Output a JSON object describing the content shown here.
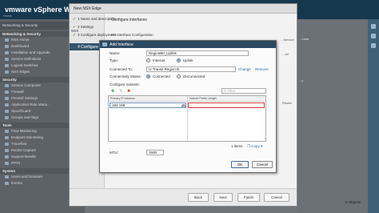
{
  "app": {
    "title": "vmware vSphere Web Client",
    "home_label": "Home"
  },
  "navigator": {
    "header": "Networking & Security",
    "sections": [
      {
        "label": "Networking & Security"
      },
      {
        "label": "Security"
      },
      {
        "label": "Tools"
      },
      {
        "label": "System"
      }
    ],
    "items": [
      {
        "label": "NSX Home"
      },
      {
        "label": "Dashboard"
      },
      {
        "label": "Installation and Upgrade"
      },
      {
        "label": "Service Definitions"
      },
      {
        "label": "Logical Switches"
      },
      {
        "label": "NSX Edges"
      },
      {
        "label": "Service Composer"
      },
      {
        "label": "Firewall"
      },
      {
        "label": "Firewall Settings"
      },
      {
        "label": "Application Rule Mana..."
      },
      {
        "label": "SpoofGuard"
      },
      {
        "label": "Groups and Tags"
      },
      {
        "label": "Flow Monitoring"
      },
      {
        "label": "Endpoint Monitoring"
      },
      {
        "label": "Traceflow"
      },
      {
        "label": "Packet Capture"
      },
      {
        "label": "Support Bundle"
      },
      {
        "label": "IPFIX"
      },
      {
        "label": "Users and Domains"
      },
      {
        "label": "Events"
      }
    ]
  },
  "wizard": {
    "title": "New NSX Edge",
    "side_label": "NSX",
    "steps": [
      {
        "check": "✓",
        "label": "1 Name and description"
      },
      {
        "check": "✓",
        "label": "2 Settings"
      },
      {
        "check": "✓",
        "label": "3 Configure deployment"
      },
      {
        "check": "",
        "label": "4 Configure interfaces"
      }
    ],
    "content_title": "Configure interfaces",
    "content_subtitle": "HA Interface Configuration",
    "behind_labels": [
      "...Service",
      "Router",
      "...dd"
    ],
    "buttons": {
      "back": "Back",
      "next": "Next",
      "finish": "Finish",
      "cancel": "Cancel"
    }
  },
  "add_interface": {
    "title": "Add Interface",
    "name_label": "Name:",
    "name_value": "RegionB0_Uplink",
    "type_label": "Type:",
    "type_options": [
      "Internal",
      "Uplink"
    ],
    "type_selected": "Uplink",
    "connected_to_label": "Connected To:",
    "connected_to_value": "U-Transit Region B",
    "change_label": "Change",
    "remove_label": "Remove",
    "status_label": "Connectivity Status:",
    "status_options": [
      "Connected",
      "Disconnected"
    ],
    "status_selected": "Connected",
    "subnets_label": "Configure subnets:",
    "filter_placeholder": "Filter",
    "grid": {
      "columns": [
        "Primary IP Address",
        "Subnet Prefix Length"
      ],
      "ip_value": "192.168."
    },
    "items_count": "1 items",
    "copy_label": "Copy",
    "mtu_label": "MTU:",
    "mtu_value": "1500",
    "ok_label": "OK",
    "cancel_label": "Cancel"
  },
  "right_panel": {
    "label_a": "...mote",
    "label_b": "...v",
    "objects_label": "6 Objects"
  },
  "colors": {
    "header": "#15384f",
    "accent": "#2b4a61",
    "error": "#d23c3c",
    "check": "#3a8a2e",
    "link": "#2a6ea8"
  }
}
